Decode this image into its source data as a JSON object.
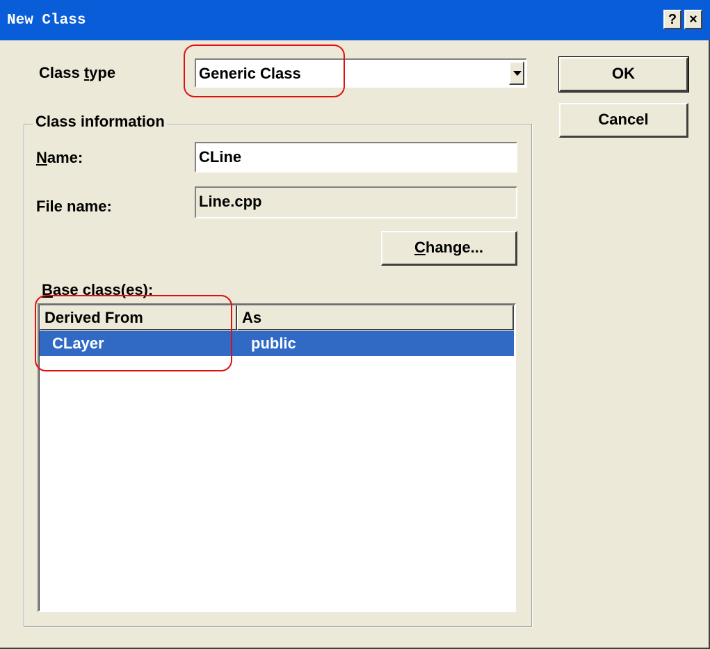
{
  "window": {
    "title": "New Class",
    "help_label": "?",
    "close_label": "×"
  },
  "class_type": {
    "label": "Class type",
    "value": "Generic Class"
  },
  "class_information": {
    "legend": "Class information",
    "name_label": "Name:",
    "name_value": "CLine",
    "file_name_label": "File name:",
    "file_name_value": "Line.cpp",
    "change_label": "Change..."
  },
  "base_classes": {
    "label": "Base class(es):",
    "columns": [
      "Derived From",
      "As"
    ],
    "rows": [
      {
        "derived_from": "CLayer",
        "as": "public",
        "selected": true
      }
    ]
  },
  "buttons": {
    "ok_label": "OK",
    "cancel_label": "Cancel"
  },
  "colors": {
    "titlebar": "#0a5dd8",
    "selection": "#316ac5",
    "dialog": "#ece9d8",
    "highlight": "#e01010"
  }
}
